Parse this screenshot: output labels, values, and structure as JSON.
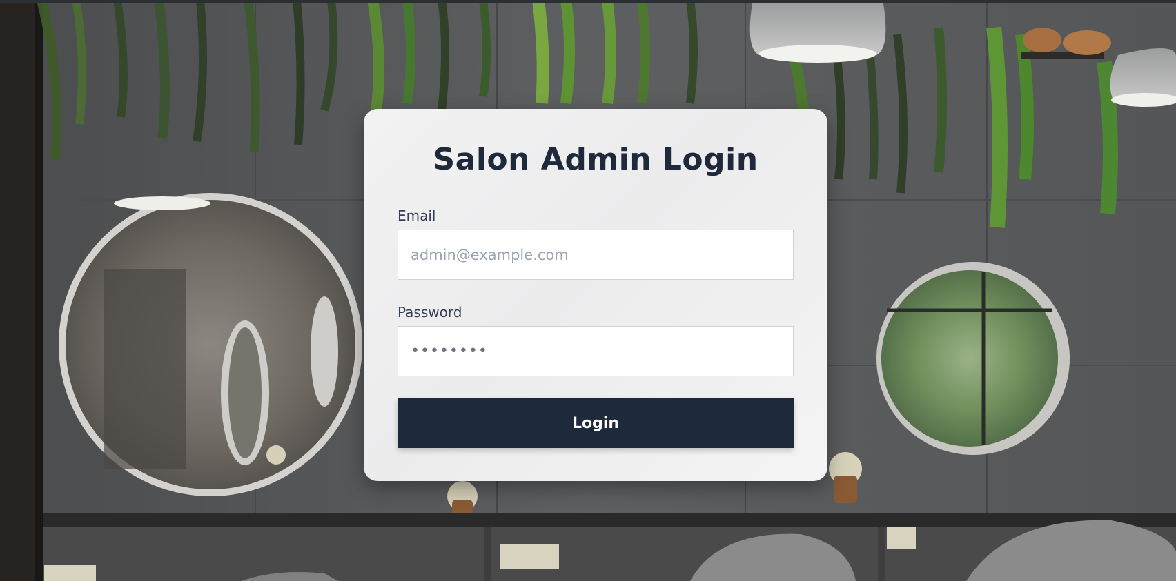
{
  "login_form": {
    "title": "Salon Admin Login",
    "email_label": "Email",
    "email_placeholder": "admin@example.com",
    "email_value": "",
    "password_label": "Password",
    "password_value": "••••••••",
    "submit_label": "Login"
  },
  "colors": {
    "primary": "#1e293b",
    "card_background": "#f0f0f1",
    "label_text": "#334155",
    "placeholder_text": "#9aa4b2"
  }
}
